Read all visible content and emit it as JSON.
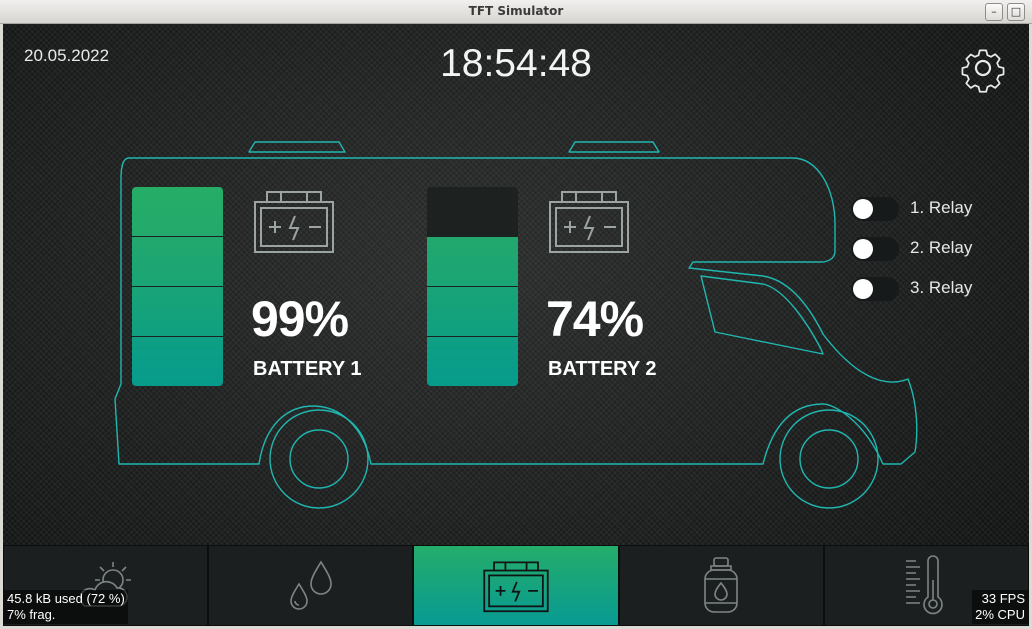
{
  "window": {
    "title": "TFT Simulator"
  },
  "header": {
    "date": "20.05.2022",
    "time": "18:54:48"
  },
  "batteries": [
    {
      "percent": "99%",
      "label": "BATTERY 1",
      "level": 0.99
    },
    {
      "percent": "74%",
      "label": "BATTERY 2",
      "level": 0.74
    }
  ],
  "relays": [
    {
      "label": "1. Relay",
      "on": false
    },
    {
      "label": "2. Relay",
      "on": false
    },
    {
      "label": "3. Relay",
      "on": false
    }
  ],
  "nav": {
    "items": [
      "weather-icon",
      "water-drops-icon",
      "battery-icon",
      "gas-bottle-icon",
      "thermometer-icon"
    ],
    "active": "battery-icon"
  },
  "stats": {
    "memory": "45.8 kB used (72 %)",
    "frag": "7% frag.",
    "fps": "33 FPS",
    "cpu": "2% CPU"
  },
  "colors": {
    "accent_top": "#25ad6a",
    "accent_bottom": "#089a93",
    "outline": "#1fb7b0"
  }
}
